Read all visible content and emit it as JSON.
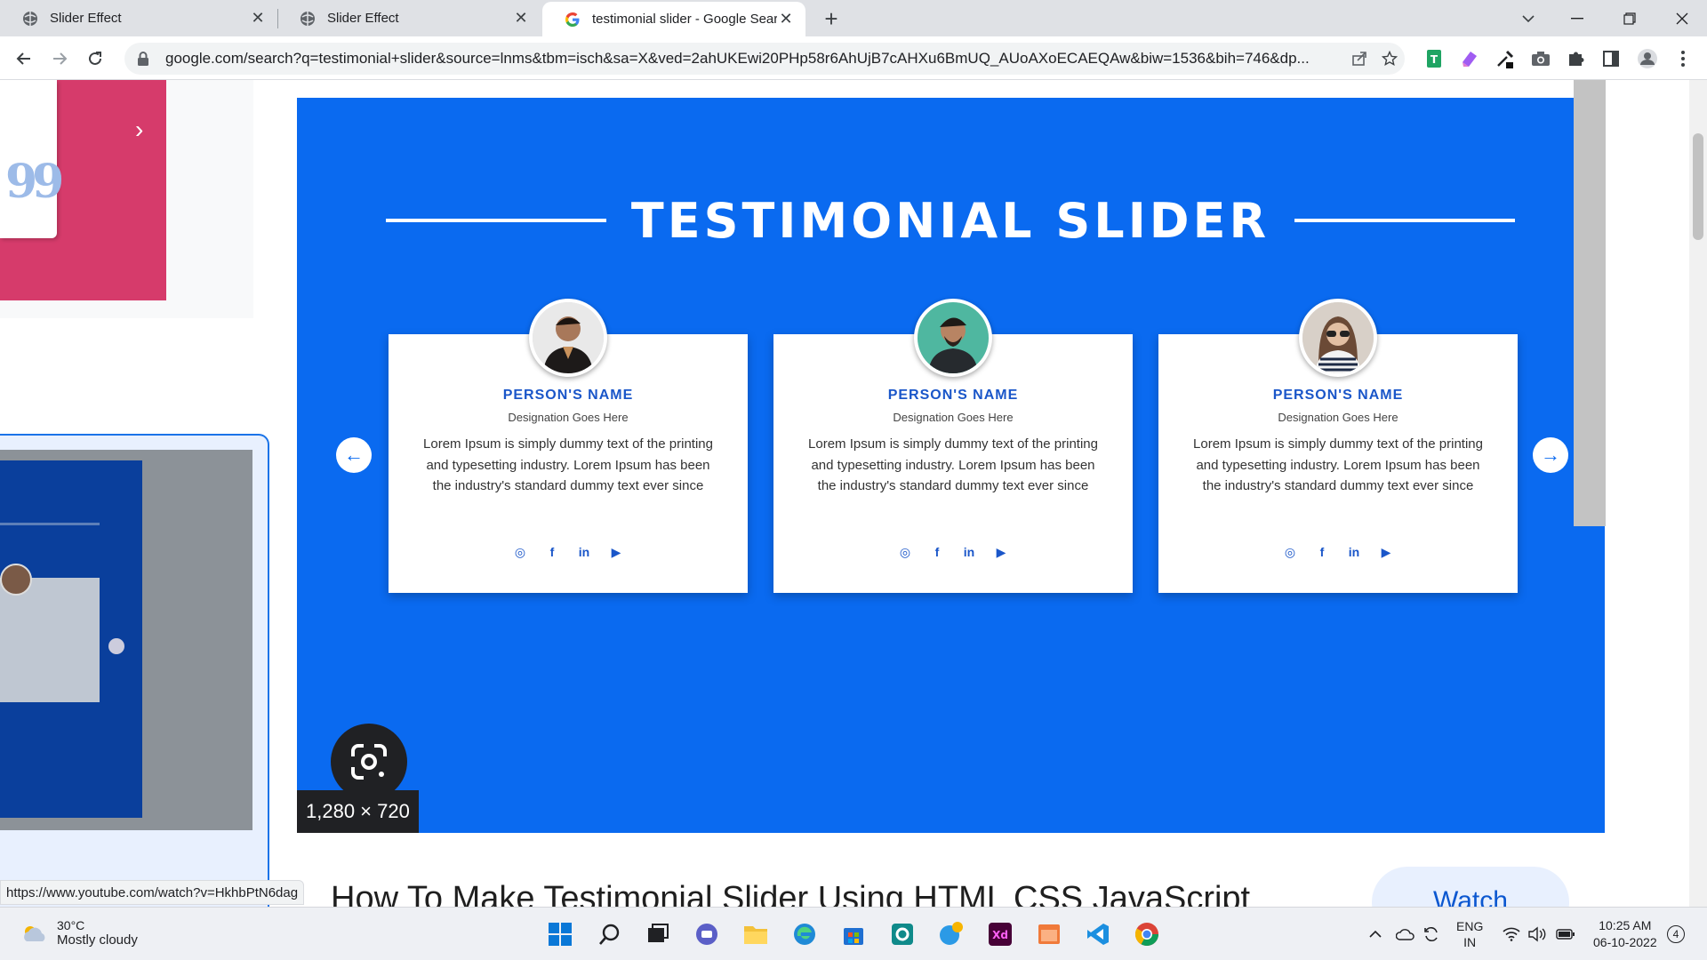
{
  "browser": {
    "tabs": [
      {
        "title": "Slider Effect",
        "active": false
      },
      {
        "title": "Slider Effect",
        "active": false
      },
      {
        "title": "testimonial slider - Google Search",
        "active": true
      }
    ],
    "new_tab_label": "+",
    "url": "google.com/search?q=testimonial+slider&source=lnms&tbm=isch&sa=X&ved=2ahUKEwi20PHp58r6AhUjB7cAHXu6BmUQ_AUoAXoECAEQAw&biw=1536&bih=746&dp...",
    "toolbar_icons": [
      "back-icon",
      "forward-icon",
      "reload-icon",
      "lock-icon",
      "share-icon",
      "star-icon"
    ],
    "extensions": [
      "green-extension-icon",
      "purple-extension-icon",
      "eyedropper-icon",
      "camera-icon",
      "puzzle-icon",
      "sidepanel-icon",
      "profile-icon",
      "menu-icon"
    ]
  },
  "preview": {
    "slider_title": "TESTIMONIAL SLIDER",
    "cards": [
      {
        "name": "PERSON'S NAME",
        "designation": "Designation Goes Here",
        "text": "Lorem Ipsum is simply dummy text of the printing and typesetting industry. Lorem Ipsum has been the industry's standard dummy text ever since",
        "avatar_color": "#3a2b24"
      },
      {
        "name": "PERSON'S NAME",
        "designation": "Designation Goes Here",
        "text": "Lorem Ipsum is simply dummy text of the printing and typesetting industry. Lorem Ipsum has been the industry's standard dummy text ever since",
        "avatar_color": "#4fb7a0"
      },
      {
        "name": "PERSON'S NAME",
        "designation": "Designation Goes Here",
        "text": "Lorem Ipsum is simply dummy text of the printing and typesetting industry. Lorem Ipsum has been the industry's standard dummy text ever since",
        "avatar_color": "#c9b8a8"
      }
    ],
    "socials": [
      "instagram-icon",
      "facebook-icon",
      "linkedin-icon",
      "youtube-icon"
    ],
    "social_labels": [
      "◎",
      "f",
      "in",
      "▶"
    ],
    "prev_arrow": "←",
    "next_arrow": "→",
    "dimensions": "1,280 × 720",
    "accent": "#0a6af0"
  },
  "result": {
    "title": "How To Make Testimonial Slider Using HTML CSS JavaScript",
    "watch_label": "Watch"
  },
  "left_thumb": {
    "quote": "99",
    "arrow": "›"
  },
  "status_bar": {
    "url": "https://www.youtube.com/watch?v=HkhbPtN6dag"
  },
  "taskbar": {
    "weather_temp": "30°C",
    "weather_condition": "Mostly cloudy",
    "language_line1": "ENG",
    "language_line2": "IN",
    "time": "10:25 AM",
    "date": "06-10-2022",
    "notification_count": "4"
  }
}
